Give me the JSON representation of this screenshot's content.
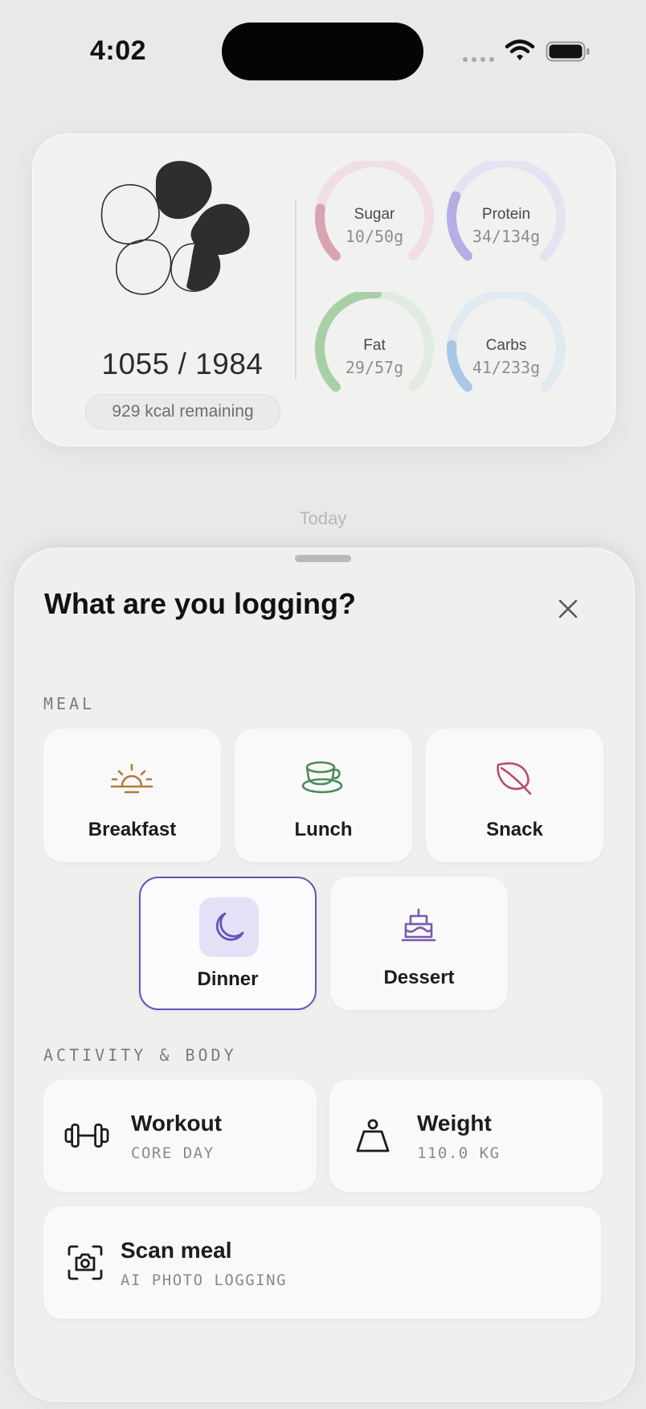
{
  "status_bar": {
    "time": "4:02"
  },
  "summary": {
    "calories": "1055 / 1984",
    "remaining": "929 kcal remaining",
    "macros": [
      {
        "name": "Sugar",
        "value": "10/50g",
        "progress": 0.2,
        "color": "#d9a3b2",
        "track": "#efdfe3"
      },
      {
        "name": "Protein",
        "value": "34/134g",
        "progress": 0.25,
        "color": "#b7ace3",
        "track": "#e6e2f2"
      },
      {
        "name": "Fat",
        "value": "29/57g",
        "progress": 0.51,
        "color": "#a9cfa6",
        "track": "#e2ebe1"
      },
      {
        "name": "Carbs",
        "value": "41/233g",
        "progress": 0.18,
        "color": "#a8c8e6",
        "track": "#e1e9f1"
      }
    ]
  },
  "today_label": "Today",
  "sheet": {
    "title": "What are you logging?",
    "meal_section": "MEAL",
    "meals": [
      {
        "label": "Breakfast",
        "icon": "sunrise-icon",
        "color": "#b07a3c"
      },
      {
        "label": "Lunch",
        "icon": "teacup-icon",
        "color": "#4d8a5a"
      },
      {
        "label": "Snack",
        "icon": "leaf-icon",
        "color": "#b5506a"
      },
      {
        "label": "Dinner",
        "icon": "moon-icon",
        "color": "#6157b8",
        "selected": true
      },
      {
        "label": "Dessert",
        "icon": "cake-icon",
        "color": "#7a5ab0"
      }
    ],
    "activity_section": "ACTIVITY & BODY",
    "workout": {
      "title": "Workout",
      "subtitle": "CORE DAY",
      "icon": "dumbbell-icon"
    },
    "weight": {
      "title": "Weight",
      "subtitle": "110.0 KG",
      "icon": "scale-weight-icon"
    },
    "scan": {
      "title": "Scan meal",
      "subtitle": "AI PHOTO LOGGING",
      "icon": "camera-scan-icon"
    }
  }
}
